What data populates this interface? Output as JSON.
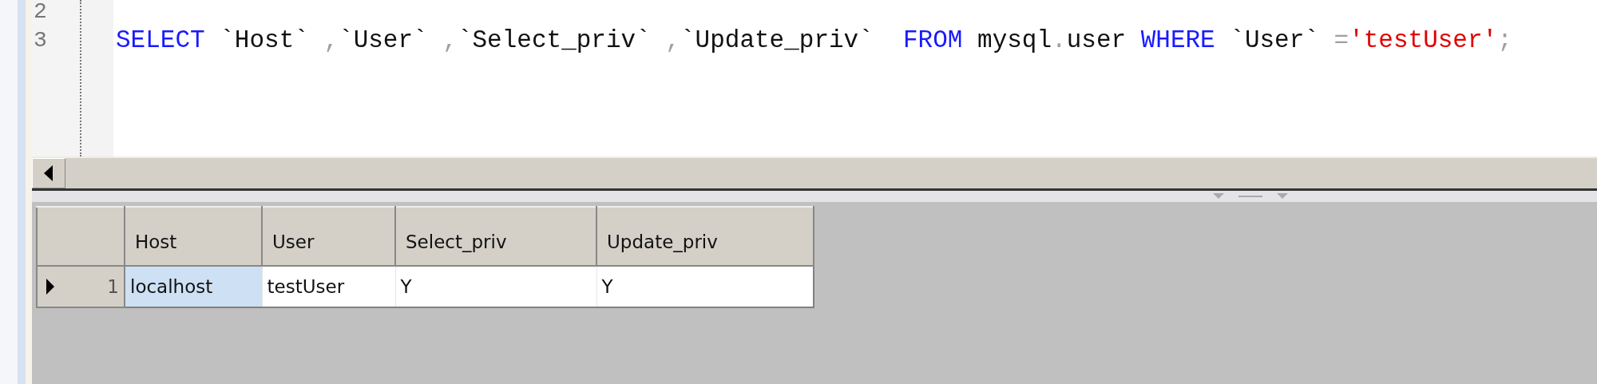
{
  "editor": {
    "lines": [
      {
        "number": "2"
      },
      {
        "number": "3",
        "tokens": [
          {
            "text": "SELECT",
            "kind": "keyword"
          },
          {
            "text": " `Host` ",
            "kind": "ident"
          },
          {
            "text": ",",
            "kind": "punct"
          },
          {
            "text": "`User` ",
            "kind": "ident"
          },
          {
            "text": ",",
            "kind": "punct"
          },
          {
            "text": "`Select_priv` ",
            "kind": "ident"
          },
          {
            "text": ",",
            "kind": "punct"
          },
          {
            "text": "`Update_priv`  ",
            "kind": "ident"
          },
          {
            "text": "FROM",
            "kind": "keyword"
          },
          {
            "text": " mysql",
            "kind": "ident"
          },
          {
            "text": ".",
            "kind": "punct"
          },
          {
            "text": "user ",
            "kind": "ident"
          },
          {
            "text": "WHERE",
            "kind": "keyword"
          },
          {
            "text": " `User` ",
            "kind": "ident"
          },
          {
            "text": "=",
            "kind": "punct"
          },
          {
            "text": "'testUser'",
            "kind": "string"
          },
          {
            "text": ";",
            "kind": "punct"
          }
        ]
      }
    ]
  },
  "results": {
    "columns": [
      "Host",
      "User",
      "Select_priv",
      "Update_priv"
    ],
    "rows": [
      {
        "number": "1",
        "current": true,
        "cells": [
          {
            "text": "localhost",
            "selected": true
          },
          {
            "text": "testUser",
            "selected": false
          },
          {
            "text": "Y",
            "selected": false
          },
          {
            "text": "Y",
            "selected": false
          }
        ]
      }
    ]
  }
}
